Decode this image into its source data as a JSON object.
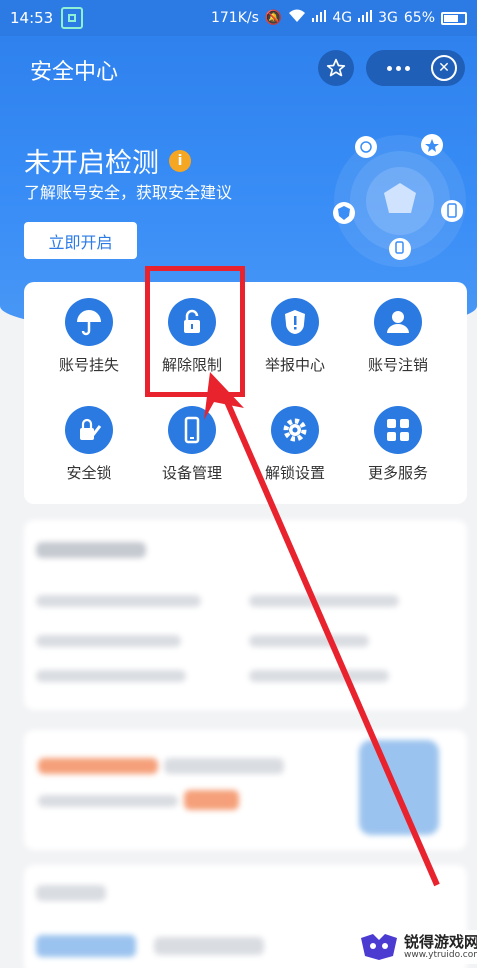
{
  "status_bar": {
    "time": "14:53",
    "speed": "171K/s",
    "network1": "4G",
    "network2": "3G",
    "battery": "65%"
  },
  "header": {
    "title": "安全中心"
  },
  "hero": {
    "title": "未开启检测",
    "subtitle": "了解账号安全，获取安全建议",
    "button": "立即开启",
    "info_icon": "i"
  },
  "grid": [
    {
      "label": "账号挂失",
      "icon": "umbrella-icon"
    },
    {
      "label": "解除限制",
      "icon": "unlock-icon"
    },
    {
      "label": "举报中心",
      "icon": "shield-alert-icon"
    },
    {
      "label": "账号注销",
      "icon": "user-icon"
    },
    {
      "label": "安全锁",
      "icon": "lock-edit-icon"
    },
    {
      "label": "设备管理",
      "icon": "phone-icon"
    },
    {
      "label": "解锁设置",
      "icon": "gear-icon"
    },
    {
      "label": "更多服务",
      "icon": "grid-icon"
    }
  ],
  "colors": {
    "brand_blue": "#2c7be5",
    "highlight_red": "#e8232e",
    "info_orange": "#f5a623"
  },
  "watermark": {
    "text": "锐得游戏网",
    "url": "www.ytruido.com"
  }
}
